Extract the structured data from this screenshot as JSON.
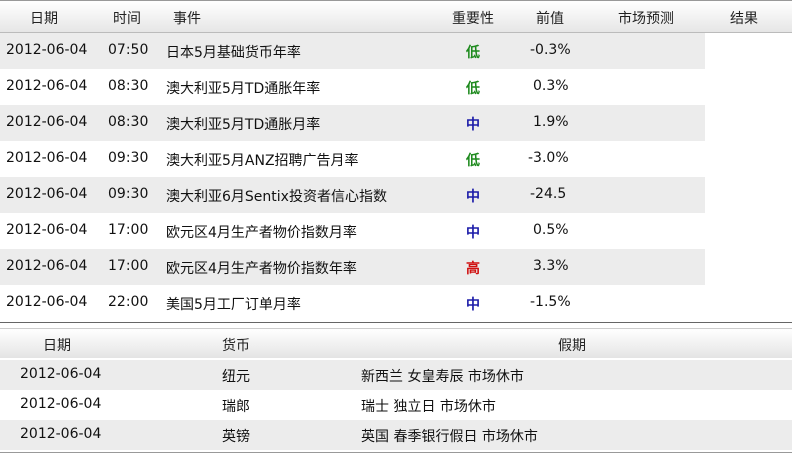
{
  "calendar": {
    "headers": {
      "date": "日期",
      "time": "时间",
      "event": "事件",
      "importance": "重要性",
      "previous": "前值",
      "forecast": "市场预测",
      "result": "结果"
    },
    "rows": [
      {
        "date": "2012-06-04",
        "time": "07:50",
        "event": "日本5月基础货币年率",
        "importance": "低",
        "level": "low",
        "previous": "-0.3%"
      },
      {
        "date": "2012-06-04",
        "time": "08:30",
        "event": "澳大利亚5月TD通胀年率",
        "importance": "低",
        "level": "low",
        "previous": "0.3%"
      },
      {
        "date": "2012-06-04",
        "time": "08:30",
        "event": "澳大利亚5月TD通胀月率",
        "importance": "中",
        "level": "mid",
        "previous": "1.9%"
      },
      {
        "date": "2012-06-04",
        "time": "09:30",
        "event": "澳大利亚5月ANZ招聘广告月率",
        "importance": "低",
        "level": "low",
        "previous": "-3.0%"
      },
      {
        "date": "2012-06-04",
        "time": "09:30",
        "event": "澳大利亚6月Sentix投资者信心指数",
        "importance": "中",
        "level": "mid",
        "previous": "-24.5"
      },
      {
        "date": "2012-06-04",
        "time": "17:00",
        "event": "欧元区4月生产者物价指数月率",
        "importance": "中",
        "level": "mid",
        "previous": "0.5%"
      },
      {
        "date": "2012-06-04",
        "time": "17:00",
        "event": "欧元区4月生产者物价指数年率",
        "importance": "高",
        "level": "high",
        "previous": "3.3%"
      },
      {
        "date": "2012-06-04",
        "time": "22:00",
        "event": "美国5月工厂订单月率",
        "importance": "中",
        "level": "mid",
        "previous": "-1.5%"
      }
    ]
  },
  "holidays": {
    "headers": {
      "date": "日期",
      "currency": "货币",
      "holiday": "假期"
    },
    "rows": [
      {
        "date": "2012-06-04",
        "currency": "纽元",
        "holiday": "新西兰 女皇寿辰 市场休市"
      },
      {
        "date": "2012-06-04",
        "currency": "瑞郎",
        "holiday": "瑞士 独立日 市场休市"
      },
      {
        "date": "2012-06-04",
        "currency": "英镑",
        "holiday": "英国 春季银行假日 市场休市"
      }
    ]
  },
  "colors": {
    "low": "#1e8a1e",
    "mid": "#1a1aa8",
    "high": "#d01010"
  }
}
